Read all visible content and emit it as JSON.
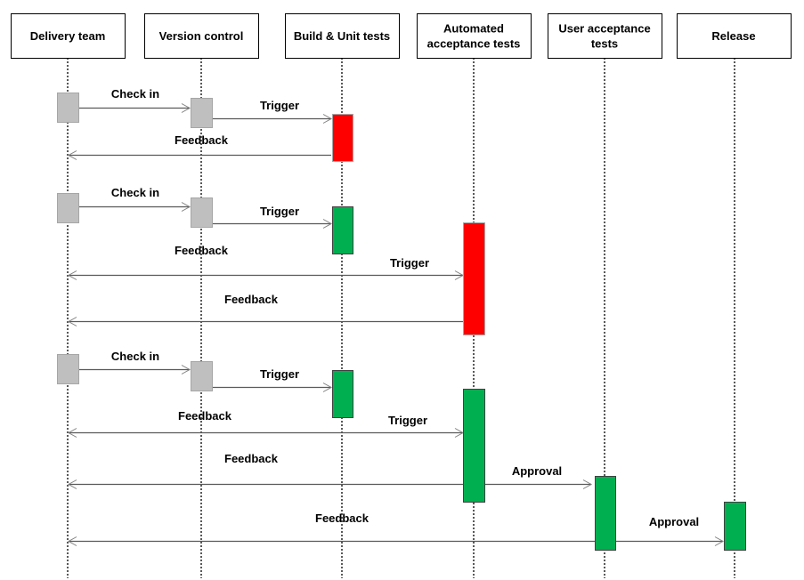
{
  "diagram": {
    "type": "sequence-diagram",
    "lanes": [
      {
        "id": "delivery",
        "label_lines": [
          "Delivery team"
        ]
      },
      {
        "id": "vc",
        "label_lines": [
          "Version control"
        ]
      },
      {
        "id": "build",
        "label_lines": [
          "Build & Unit tests"
        ]
      },
      {
        "id": "aat",
        "label_lines": [
          "Automated",
          "acceptance tests"
        ]
      },
      {
        "id": "uat",
        "label_lines": [
          "User acceptance",
          "tests"
        ]
      },
      {
        "id": "release",
        "label_lines": [
          "Release"
        ]
      }
    ],
    "colors": {
      "neutral": "#BFBFBF",
      "fail": "#FF0000",
      "pass": "#00B050",
      "line": "#595959"
    },
    "activations": [
      {
        "lane": "delivery",
        "state": "neutral",
        "round": 1,
        "order": 1
      },
      {
        "lane": "vc",
        "state": "neutral",
        "round": 1,
        "order": 2
      },
      {
        "lane": "build",
        "state": "fail",
        "round": 1,
        "order": 3
      },
      {
        "lane": "delivery",
        "state": "neutral",
        "round": 2,
        "order": 1
      },
      {
        "lane": "vc",
        "state": "neutral",
        "round": 2,
        "order": 2
      },
      {
        "lane": "build",
        "state": "pass",
        "round": 2,
        "order": 3
      },
      {
        "lane": "aat",
        "state": "fail",
        "round": 2,
        "order": 4
      },
      {
        "lane": "delivery",
        "state": "neutral",
        "round": 3,
        "order": 1
      },
      {
        "lane": "vc",
        "state": "neutral",
        "round": 3,
        "order": 2
      },
      {
        "lane": "build",
        "state": "pass",
        "round": 3,
        "order": 3
      },
      {
        "lane": "aat",
        "state": "pass",
        "round": 3,
        "order": 4
      },
      {
        "lane": "uat",
        "state": "pass",
        "round": 3,
        "order": 5
      },
      {
        "lane": "release",
        "state": "pass",
        "round": 3,
        "order": 6
      }
    ],
    "messages": [
      {
        "label": "Check in",
        "from": "delivery",
        "to": "vc",
        "round": 1
      },
      {
        "label": "Trigger",
        "from": "vc",
        "to": "build",
        "round": 1
      },
      {
        "label": "Feedback",
        "from": "build",
        "to": "delivery",
        "round": 1
      },
      {
        "label": "Check in",
        "from": "delivery",
        "to": "vc",
        "round": 2
      },
      {
        "label": "Trigger",
        "from": "vc",
        "to": "build",
        "round": 2
      },
      {
        "label": "Feedback",
        "from": "build",
        "to": "delivery",
        "round": 2,
        "note": "label only, no line"
      },
      {
        "label": "Trigger",
        "from": "delivery",
        "to": "aat",
        "round": 2,
        "bidirectional": true
      },
      {
        "label": "Feedback",
        "from": "aat",
        "to": "delivery",
        "round": 2
      },
      {
        "label": "Check in",
        "from": "delivery",
        "to": "vc",
        "round": 3
      },
      {
        "label": "Trigger",
        "from": "vc",
        "to": "build",
        "round": 3
      },
      {
        "label": "Feedback",
        "from": "build",
        "to": "delivery",
        "round": 3,
        "note": "label only"
      },
      {
        "label": "Trigger",
        "from": "delivery",
        "to": "aat",
        "round": 3,
        "bidirectional": true
      },
      {
        "label": "Feedback",
        "from": "aat",
        "to": "delivery",
        "round": 3
      },
      {
        "label": "Approval",
        "from": "aat",
        "to": "uat",
        "round": 3
      },
      {
        "label": "Feedback",
        "from": "uat",
        "to": "delivery",
        "round": 3
      },
      {
        "label": "Approval",
        "from": "uat",
        "to": "release",
        "round": 3
      }
    ]
  }
}
